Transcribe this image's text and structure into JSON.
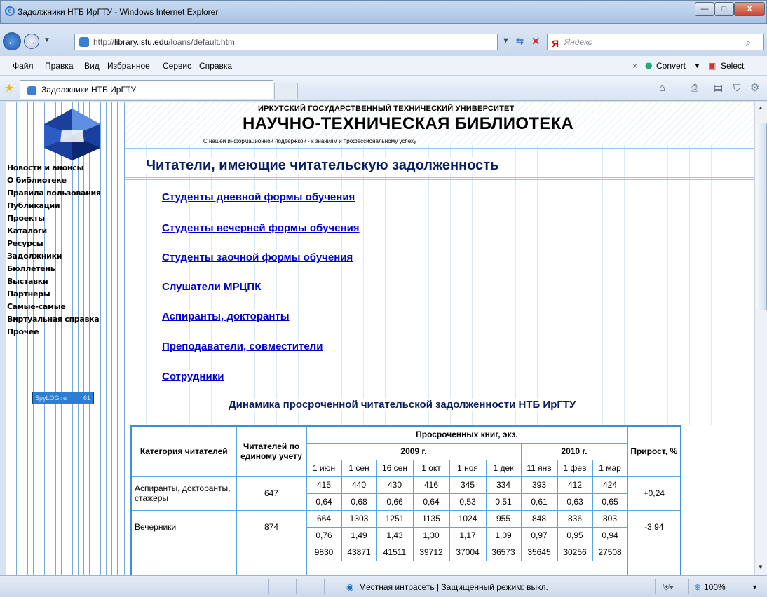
{
  "window": {
    "title": "Задолжники НТБ ИрГТУ - Windows Internet Explorer",
    "minimize": "—",
    "maximize": "□",
    "close": "X"
  },
  "address": {
    "url_prefix": "http://",
    "url_host": "library.istu.edu",
    "url_path": "/loans/default.htm",
    "search_engine": "Яндекс"
  },
  "menu": {
    "items": [
      "Файл",
      "Правка",
      "Вид",
      "Избранное",
      "Сервис",
      "Справка"
    ],
    "convert": "Convert",
    "select": "Select"
  },
  "tab": {
    "label": "Задолжники НТБ ИрГТУ"
  },
  "site": {
    "univ": "ИРКУТСКИЙ ГОСУДАРСТВЕННЫЙ ТЕХНИЧЕСКИЙ УНИВЕРСИТЕТ",
    "lib": "НАУЧНО-ТЕХНИЧЕСКАЯ БИБЛИОТЕКА",
    "motto": "С нашей информационной поддержкой - к знаниям и профессиональному успеху"
  },
  "nav": [
    "Новости и анонсы",
    "О библиотеке",
    "Правила пользования",
    "Публикации",
    "Проекты",
    "Каталоги",
    "Ресурсы",
    "Задолжники",
    "Бюллетень",
    "Выставки",
    "Партнеры",
    "Самые-самые",
    "Виртуальная справка",
    "Прочее"
  ],
  "counter": {
    "label": "SpyLOG.ru",
    "value": "61"
  },
  "page": {
    "title": "Читатели, имеющие читательскую задолженность",
    "links": [
      "Студенты дневной формы обучения",
      "Студенты вечерней формы обучения",
      "Студенты заочной формы обучения",
      "Слушатели МРЦПК",
      "Аспиранты, докторанты",
      "Преподаватели, совместители",
      "Сотрудники"
    ],
    "dyn_title": "Динамика просроченной читательской задолженности НТБ ИрГТУ"
  },
  "table": {
    "h_category": "Категория читателей",
    "h_readers": "Читателей по единому учету",
    "h_books": "Просроченных книг, экз.",
    "h_2009": "2009 г.",
    "h_2010": "2010 г.",
    "h_growth": "Прирост, %",
    "months": [
      "1 июн",
      "1 сен",
      "16 сен",
      "1 окт",
      "1 ноя",
      "1 дек",
      "11 янв",
      "1 фев",
      "1 мар"
    ],
    "rows": [
      {
        "category": "Аспиранты, докторанты, стажеры",
        "readers": "647",
        "counts": [
          "415",
          "440",
          "430",
          "416",
          "345",
          "334",
          "393",
          "412",
          "424"
        ],
        "ratios": [
          "0,64",
          "0,68",
          "0,66",
          "0,64",
          "0,53",
          "0,51",
          "0,61",
          "0,63",
          "0,65"
        ],
        "growth": "+0,24"
      },
      {
        "category": "Вечерники",
        "readers": "874",
        "counts": [
          "664",
          "1303",
          "1251",
          "1135",
          "1024",
          "955",
          "848",
          "836",
          "803"
        ],
        "ratios": [
          "0,76",
          "1,49",
          "1,43",
          "1,30",
          "1,17",
          "1,09",
          "0,97",
          "0,95",
          "0,94"
        ],
        "growth": "-3,94"
      },
      {
        "category": "",
        "readers": "",
        "counts": [
          "9830",
          "43871",
          "41511",
          "39712",
          "37004",
          "36573",
          "35645",
          "30256",
          "27508"
        ],
        "ratios": [],
        "growth": ""
      }
    ]
  },
  "status": {
    "zone": "Местная интрасеть | Защищенный режим: выкл.",
    "zoom": "100%"
  }
}
